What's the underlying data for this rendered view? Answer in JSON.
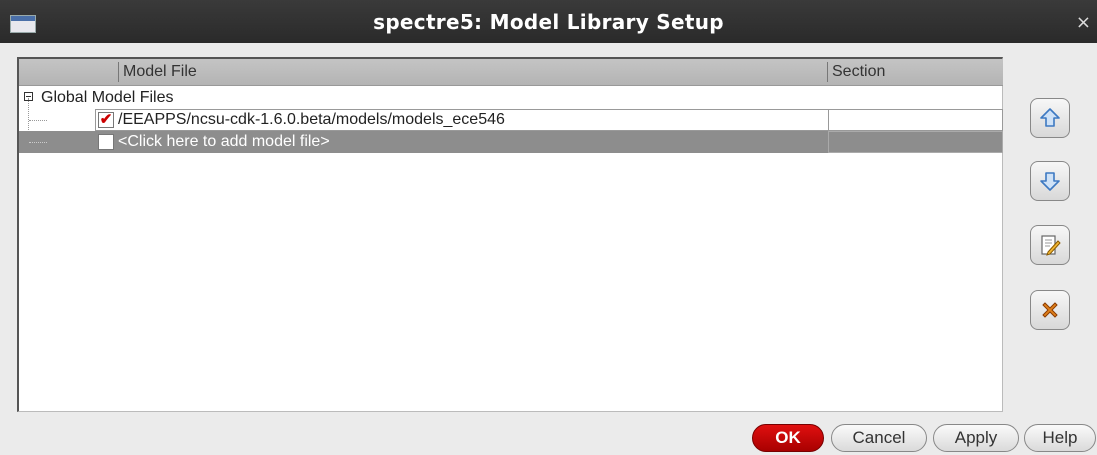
{
  "window": {
    "title": "spectre5: Model Library Setup",
    "close_glyph": "×"
  },
  "table": {
    "columns": [
      "",
      "Model File",
      "Section"
    ],
    "group_label": "Global Model Files",
    "rows": [
      {
        "checked": true,
        "model_file": "/EEAPPS/ncsu-cdk-1.6.0.beta/models/models_ece546",
        "section": ""
      },
      {
        "checked": false,
        "model_file": "<Click here to add model file>",
        "section": ""
      }
    ]
  },
  "side_buttons": [
    {
      "icon": "arrow-up-icon",
      "label": "Move Up"
    },
    {
      "icon": "arrow-down-icon",
      "label": "Move Down"
    },
    {
      "icon": "edit-icon",
      "label": "Edit"
    },
    {
      "icon": "delete-icon",
      "label": "Delete"
    }
  ],
  "buttons": {
    "ok": "OK",
    "cancel": "Cancel",
    "apply": "Apply",
    "help": "Help"
  },
  "colors": {
    "ok_button": "#cc0000",
    "selected_row": "#8d8d8d",
    "check_mark": "#cc0000",
    "title_bar": "#2f2f2f"
  }
}
